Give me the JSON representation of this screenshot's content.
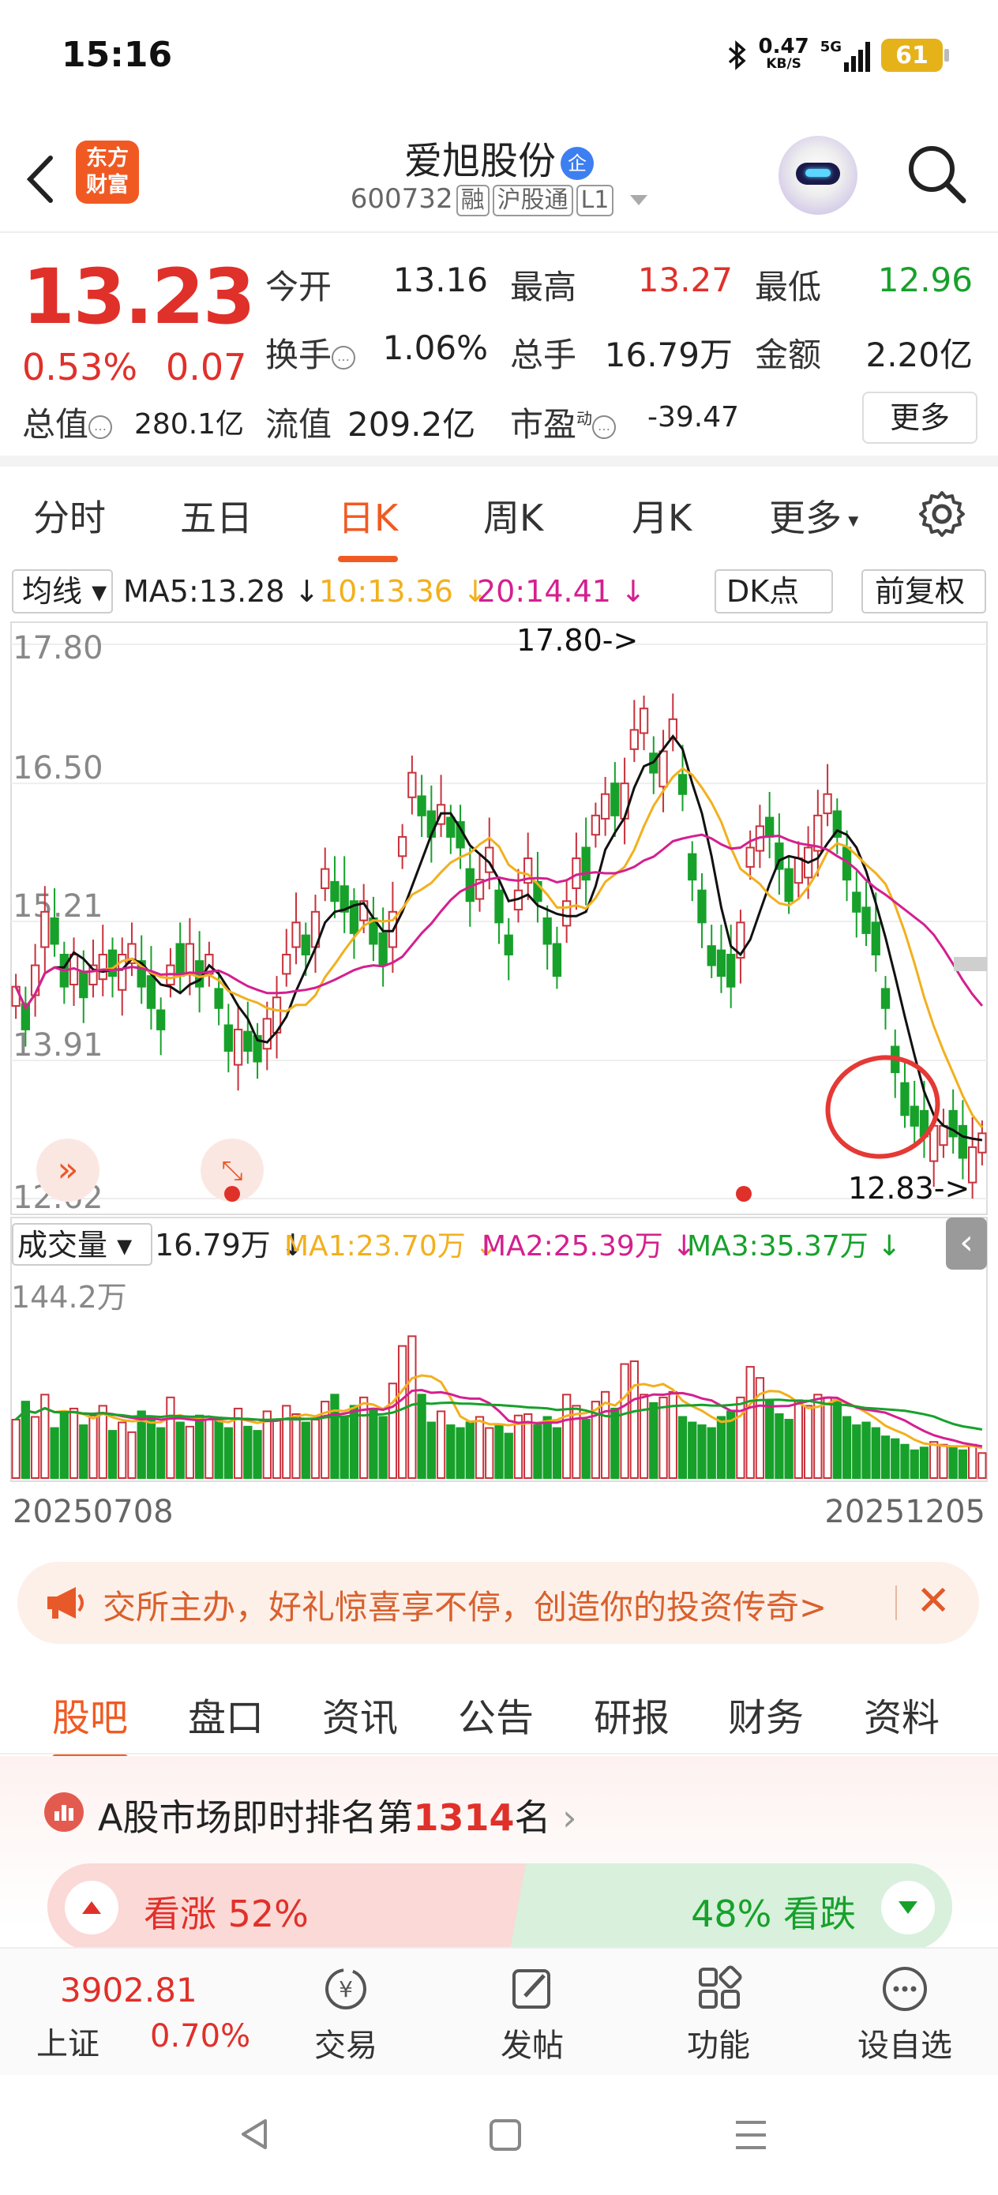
{
  "status_bar": {
    "time": "15:16",
    "net_speed": "0.47",
    "net_unit": "KB/S",
    "signal": "5G",
    "battery": "61"
  },
  "header": {
    "logo_line1": "东方",
    "logo_line2": "财富",
    "stock_name": "爱旭股份",
    "badge": "企",
    "code": "600732",
    "tags": [
      "融",
      "沪股通",
      "L1"
    ]
  },
  "quote": {
    "price": "13.23",
    "pct": "0.53%",
    "change": "0.07",
    "open_label": "今开",
    "open": "13.16",
    "high_label": "最高",
    "high": "13.27",
    "low_label": "最低",
    "low": "12.96",
    "turnover_label": "换手",
    "turnover": "1.06%",
    "volume_label": "总手",
    "volume": "16.79万",
    "amount_label": "金额",
    "amount": "2.20亿",
    "mktcap_label": "总值",
    "mktcap": "280.1亿",
    "float_label": "流值",
    "float": "209.2亿",
    "pe_label": "市盈",
    "pe_sup": "动",
    "pe": "-39.47",
    "more": "更多"
  },
  "tabs": [
    "分时",
    "五日",
    "日K",
    "周K",
    "月K",
    "更多"
  ],
  "active_tab": "日K",
  "chart_data": {
    "type": "candlestick",
    "ma_selector": "均线",
    "ma5": "MA5:13.28",
    "ma10": "10:13.36",
    "ma20": "20:14.41",
    "dk_button": "DK点",
    "adjust_button": "前复权",
    "y_ticks": [
      "17.80",
      "16.50",
      "15.21",
      "13.91",
      "12.62"
    ],
    "ylim": [
      12.62,
      17.8
    ],
    "high_marker": "17.80->",
    "low_marker": "12.83->",
    "vol_selector": "成交量",
    "vol_value": "16.79万",
    "vol_ma1": "MA1:23.70万",
    "vol_ma2": "MA2:25.39万",
    "vol_ma3": "MA3:35.37万",
    "vol_max": "144.2万",
    "x_start": "20250708",
    "x_end": "20251205",
    "ma_colors": {
      "ma5": "#111111",
      "ma10": "#f2b01e",
      "ma20": "#d4208f",
      "vmaA": "#f2b01e",
      "vmaB": "#d4208f",
      "vmaC": "#17a12b"
    },
    "up_color": "#c8323c",
    "down_color": "#17a12b",
    "closes": [
      14.6,
      14.2,
      14.8,
      15.3,
      15.0,
      14.6,
      14.9,
      14.5,
      14.8,
      14.9,
      14.7,
      14.9,
      15.0,
      14.6,
      14.4,
      14.2,
      14.8,
      14.7,
      15.0,
      14.6,
      14.9,
      14.4,
      14.0,
      14.2,
      14.0,
      13.9,
      14.3,
      14.5,
      14.9,
      15.2,
      14.9,
      15.3,
      15.7,
      15.4,
      15.3,
      15.1,
      15.4,
      15.0,
      14.8,
      15.3,
      16.0,
      16.6,
      16.2,
      16.0,
      16.3,
      16.0,
      15.9,
      15.4,
      15.6,
      15.9,
      15.2,
      14.9,
      15.5,
      15.8,
      15.4,
      15.0,
      14.7,
      15.4,
      15.8,
      15.6,
      16.2,
      16.4,
      16.2,
      16.5,
      17.0,
      17.2,
      16.6,
      16.8,
      17.1,
      16.4,
      15.6,
      15.2,
      14.8,
      14.7,
      14.6,
      15.2,
      15.9,
      16.1,
      16.0,
      15.7,
      15.4,
      15.8,
      15.9,
      16.2,
      16.4,
      16.0,
      15.6,
      15.3,
      15.1,
      14.9,
      14.4,
      13.8,
      13.4,
      13.3,
      13.2,
      13.3,
      13.3,
      13.2,
      13.0,
      13.1,
      13.23
    ],
    "volumes": [
      42,
      55,
      44,
      60,
      36,
      46,
      50,
      38,
      45,
      52,
      34,
      40,
      33,
      48,
      44,
      36,
      58,
      40,
      37,
      45,
      42,
      41,
      36,
      50,
      37,
      34,
      48,
      42,
      52,
      46,
      40,
      42,
      55,
      60,
      44,
      52,
      58,
      50,
      44,
      68,
      95,
      102,
      60,
      40,
      48,
      38,
      36,
      40,
      44,
      36,
      38,
      32,
      45,
      46,
      38,
      44,
      36,
      60,
      52,
      42,
      55,
      62,
      50,
      82,
      84,
      60,
      54,
      58,
      62,
      44,
      40,
      38,
      36,
      44,
      48,
      58,
      80,
      72,
      55,
      46,
      42,
      56,
      52,
      60,
      58,
      56,
      44,
      38,
      40,
      36,
      30,
      28,
      24,
      20,
      22,
      26,
      24,
      22,
      20,
      24,
      18
    ],
    "ups": [
      1,
      0,
      1,
      1,
      0,
      0,
      1,
      0,
      1,
      1,
      0,
      1,
      1,
      0,
      0,
      0,
      1,
      0,
      1,
      0,
      1,
      0,
      0,
      1,
      0,
      0,
      1,
      1,
      1,
      1,
      0,
      1,
      1,
      0,
      0,
      0,
      1,
      0,
      0,
      1,
      1,
      1,
      0,
      0,
      1,
      0,
      0,
      0,
      1,
      1,
      0,
      0,
      1,
      1,
      0,
      0,
      0,
      1,
      1,
      0,
      1,
      1,
      0,
      1,
      1,
      1,
      0,
      1,
      1,
      0,
      0,
      0,
      0,
      0,
      0,
      1,
      1,
      1,
      0,
      0,
      0,
      1,
      1,
      1,
      1,
      0,
      0,
      0,
      0,
      0,
      0,
      0,
      0,
      0,
      0,
      1,
      1,
      0,
      0,
      1,
      1
    ]
  },
  "banner": {
    "text": "交所主办，好礼惊喜享不停，创造你的投资传奇>",
    "close": "✕"
  },
  "subtabs": [
    "股吧",
    "盘口",
    "资讯",
    "公告",
    "研报",
    "财务",
    "资料"
  ],
  "active_subtab": "股吧",
  "rank": {
    "prefix": "A股市场即时排名第",
    "number": "1314",
    "suffix": "名",
    "arrow": "›"
  },
  "sentiment": {
    "bull_label": "看涨 52%",
    "bear_label": "48% 看跌",
    "bull_pct": 52,
    "bear_pct": 48
  },
  "bottom_nav": {
    "index_value": "3902.81",
    "index_name": "上证",
    "index_pct": "0.70%",
    "items": [
      "交易",
      "发帖",
      "功能",
      "设自选"
    ]
  },
  "icons": [
    "bluetooth-icon",
    "signal-icon",
    "back-icon",
    "search-icon",
    "settings-icon",
    "megaphone-icon",
    "close-icon",
    "chevron-right-icon",
    "expand-icon",
    "double-chevron-icon"
  ]
}
